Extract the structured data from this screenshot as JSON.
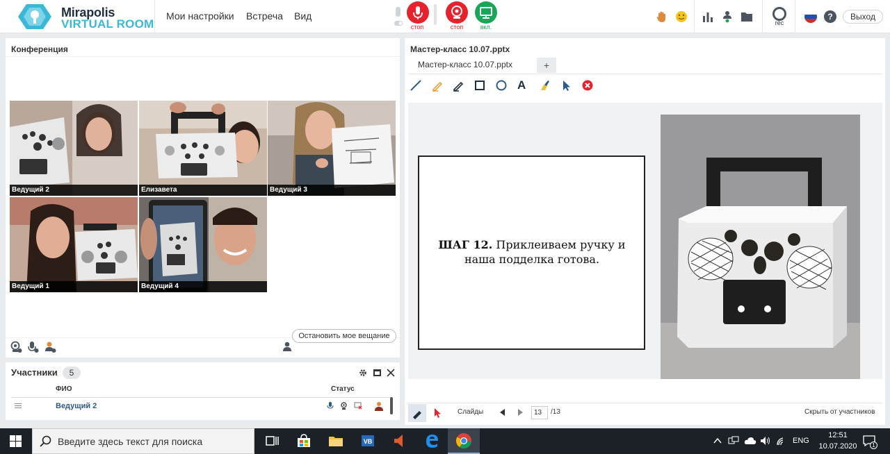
{
  "header": {
    "logo_name": "Mirapolis",
    "logo_sub": "VIRTUAL ROOM",
    "menu": [
      "Мои настройки",
      "Встреча",
      "Вид"
    ],
    "mic_label": "стоп",
    "cam_label": "стоп",
    "screen_label": "вкл.",
    "rec_label": "rec",
    "exit_label": "Выход",
    "colors": {
      "stop": "#e8222d",
      "on": "#1aa558",
      "accent": "#3ab8d8"
    }
  },
  "conference": {
    "title": "Конференция",
    "tiles": [
      "Ведущий 2",
      "Елизавета",
      "Ведущий 3",
      "Ведущий  1",
      "Ведущий 4"
    ],
    "stop_broadcast_label": "Остановить мое вещание"
  },
  "participants": {
    "title": "Участники",
    "count": "5",
    "col_name": "ФИО",
    "col_status": "Статус",
    "rows": [
      {
        "name": "Ведущий 2"
      }
    ]
  },
  "presentation": {
    "title": "Мастер-класс 10.07.pptx",
    "tab_label": "Мастер-класс 10.07.pptx",
    "tab_add": "+",
    "slide_step": "ШАГ 12.",
    "slide_text1": "Приклеиваем ручку и",
    "slide_text2": "наша подделка готова.",
    "slides_label": "Слайды",
    "page_value": "13",
    "page_total": "/13",
    "hide_label": "Скрыть от участников"
  },
  "taskbar": {
    "search_placeholder": "Введите здесь текст для поиска",
    "lang": "ENG",
    "time": "12:51",
    "date": "10.07.2020",
    "notification_count": "1"
  }
}
